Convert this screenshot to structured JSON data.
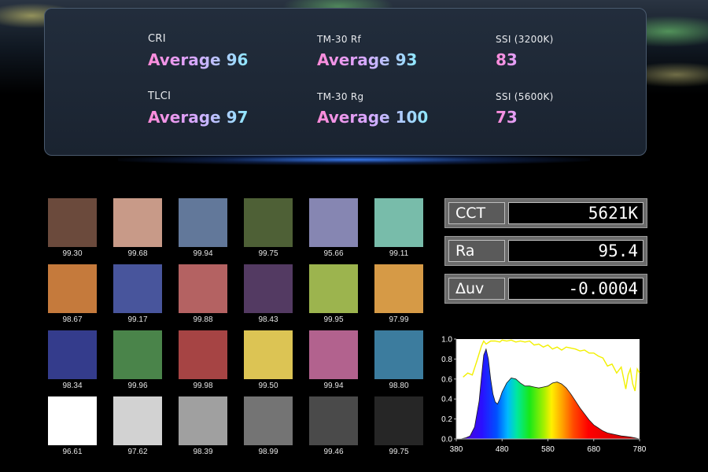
{
  "metrics": [
    {
      "label": "CRI",
      "value": "Average 96"
    },
    {
      "label": "TM-30 Rf",
      "value": "Average 93"
    },
    {
      "label": "SSI (3200K)",
      "value": "83"
    },
    {
      "label": "TLCI",
      "value": "Average 97"
    },
    {
      "label": "TM-30 Rg",
      "value": "Average 100"
    },
    {
      "label": "SSI (5600K)",
      "value": "73"
    }
  ],
  "swatches": [
    {
      "color": "#6b4a3c",
      "value": "99.30"
    },
    {
      "color": "#c89a88",
      "value": "99.68"
    },
    {
      "color": "#62789a",
      "value": "99.94"
    },
    {
      "color": "#4e6036",
      "value": "99.75"
    },
    {
      "color": "#8686b2",
      "value": "95.66"
    },
    {
      "color": "#78bcaa",
      "value": "99.11"
    },
    {
      "color": "#c57a3c",
      "value": "98.67"
    },
    {
      "color": "#48559c",
      "value": "99.17"
    },
    {
      "color": "#b46262",
      "value": "99.88"
    },
    {
      "color": "#533a62",
      "value": "98.43"
    },
    {
      "color": "#9cb44e",
      "value": "99.95"
    },
    {
      "color": "#d69a46",
      "value": "97.99"
    },
    {
      "color": "#343c8c",
      "value": "98.34"
    },
    {
      "color": "#4a844a",
      "value": "99.96"
    },
    {
      "color": "#a64444",
      "value": "99.98"
    },
    {
      "color": "#dcc454",
      "value": "99.50"
    },
    {
      "color": "#b2628e",
      "value": "99.94"
    },
    {
      "color": "#3c7c9e",
      "value": "98.80"
    },
    {
      "color": "#ffffff",
      "value": "96.61"
    },
    {
      "color": "#d2d2d2",
      "value": "97.62"
    },
    {
      "color": "#a0a0a0",
      "value": "98.39"
    },
    {
      "color": "#747474",
      "value": "98.99"
    },
    {
      "color": "#4a4a4a",
      "value": "99.46"
    },
    {
      "color": "#262626",
      "value": "99.75"
    }
  ],
  "readouts": [
    {
      "key": "CCT",
      "value": "5621K"
    },
    {
      "key": "Ra",
      "value": "95.4"
    },
    {
      "key": "Δuv",
      "value": "-0.0004"
    }
  ],
  "chart_data": {
    "type": "area",
    "x_ticks": [
      380,
      480,
      580,
      680,
      780
    ],
    "y_ticks": [
      "0.0",
      "0.2",
      "0.4",
      "0.6",
      "0.8",
      "1.0"
    ],
    "xlim": [
      380,
      780
    ],
    "ylim": [
      0,
      1.0
    ],
    "grid": false,
    "series": [
      {
        "style": "spectrum-fill",
        "x": [
          380,
          390,
          400,
          410,
          420,
          430,
          435,
          440,
          445,
          450,
          455,
          460,
          465,
          470,
          475,
          480,
          490,
          500,
          510,
          520,
          530,
          540,
          550,
          560,
          570,
          580,
          590,
          600,
          610,
          620,
          630,
          640,
          650,
          660,
          670,
          680,
          690,
          700,
          710,
          720,
          730,
          740,
          750,
          760,
          770,
          780
        ],
        "y": [
          0.0,
          0.0,
          0.01,
          0.03,
          0.12,
          0.38,
          0.62,
          0.84,
          0.9,
          0.8,
          0.6,
          0.45,
          0.37,
          0.35,
          0.4,
          0.47,
          0.56,
          0.61,
          0.6,
          0.56,
          0.53,
          0.53,
          0.52,
          0.51,
          0.52,
          0.53,
          0.56,
          0.57,
          0.55,
          0.51,
          0.45,
          0.38,
          0.31,
          0.25,
          0.19,
          0.14,
          0.11,
          0.08,
          0.06,
          0.05,
          0.04,
          0.03,
          0.025,
          0.02,
          0.01,
          0.0
        ]
      },
      {
        "style": "yellow-line",
        "x": [
          395,
          405,
          415,
          425,
          435,
          440,
          445,
          455,
          465,
          475,
          480,
          490,
          500,
          510,
          520,
          530,
          540,
          550,
          560,
          570,
          580,
          590,
          600,
          610,
          620,
          630,
          640,
          650,
          660,
          670,
          680,
          690,
          700,
          710,
          720,
          730,
          740,
          750,
          755,
          760,
          765,
          770,
          775,
          780
        ],
        "y": [
          0.62,
          0.66,
          0.64,
          0.78,
          0.93,
          0.98,
          0.95,
          0.98,
          0.98,
          0.97,
          0.99,
          0.98,
          0.99,
          0.97,
          0.98,
          0.97,
          0.98,
          0.94,
          0.95,
          0.92,
          0.94,
          0.9,
          0.92,
          0.89,
          0.92,
          0.91,
          0.9,
          0.88,
          0.89,
          0.86,
          0.86,
          0.83,
          0.81,
          0.73,
          0.75,
          0.66,
          0.72,
          0.5,
          0.64,
          0.7,
          0.55,
          0.48,
          0.7,
          0.66
        ]
      }
    ]
  }
}
